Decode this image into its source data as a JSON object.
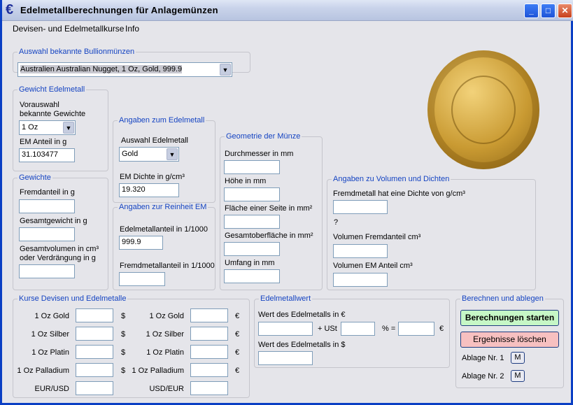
{
  "window": {
    "title": "Edelmetallberechnungen für Anlagemünzen",
    "icon": "euro-icon",
    "min": "_",
    "max": "□",
    "close": "✕"
  },
  "menu": [
    "Devisen- und Edelmetallkurse",
    "Info"
  ],
  "bullion": {
    "legend": "Auswahl bekannte Bullionmünzen",
    "value": "Australien Australian Nugget, 1 Oz, Gold, 999.9"
  },
  "gewicht": {
    "legend": "Gewicht Edelmetall",
    "vorauswahl1": "Vorauswahl",
    "vorauswahl2": "bekannte Gewichte",
    "value": "1 Oz",
    "em_label": "EM Anteil in g",
    "em_value": "31.103477"
  },
  "gewichte": {
    "legend": "Gewichte",
    "fremd": "Fremdanteil in g",
    "gesamt": "Gesamtgewicht in g",
    "vol1": "Gesamtvolumen in cm³",
    "vol2": "oder Verdrängung in g"
  },
  "edel": {
    "legend": "Angaben zum Edelmetall",
    "auswahl": "Auswahl Edelmetall",
    "value": "Gold",
    "dichte_label": "EM Dichte in g/cm³",
    "dichte": "19.320"
  },
  "reinheit": {
    "legend": "Angaben zur Reinheit EM",
    "em": "Edelmetallanteil in 1/1000",
    "em_value": "999.9",
    "fremd": "Fremdmetallanteil in 1/1000"
  },
  "geometrie": {
    "legend": "Geometrie der Münze",
    "d": "Durchmesser in mm",
    "h": "Höhe in mm",
    "f": "Fläche einer Seite in mm²",
    "g": "Gesamtoberfläche in mm²",
    "u": "Umfang in mm"
  },
  "volumen": {
    "legend": "Angaben zu Volumen und Dichten",
    "fd": "Fremdmetall hat eine Dichte von g/cm³",
    "q": "?",
    "vf": "Volumen Fremdanteil cm³",
    "ve": "Volumen EM Anteil cm³"
  },
  "kurse": {
    "legend": "Kurse Devisen und Edelmetalle",
    "rows": [
      "1 Oz Gold",
      "1 Oz Silber",
      "1 Oz Platin",
      "1 Oz Palladium"
    ],
    "usd": "$",
    "eur": "€",
    "eurusd": "EUR/USD",
    "usdeur": "USD/EUR"
  },
  "wert": {
    "legend": "Edelmetallwert",
    "eur": "Wert des Edelmetalls in €",
    "ust": "+ USt",
    "pct": "% =",
    "cur": "€",
    "usd": "Wert des Edelmetalls in $"
  },
  "berechnen": {
    "legend": "Berechnen und ablegen",
    "start": "Berechnungen starten",
    "clear": "Ergebnisse löschen",
    "a1": "Ablage Nr. 1",
    "a2": "Ablage Nr. 2",
    "m": "M"
  },
  "colors": {
    "start": "#c6f7c6",
    "clear": "#f7c0c0",
    "legend": "#1544c2"
  }
}
